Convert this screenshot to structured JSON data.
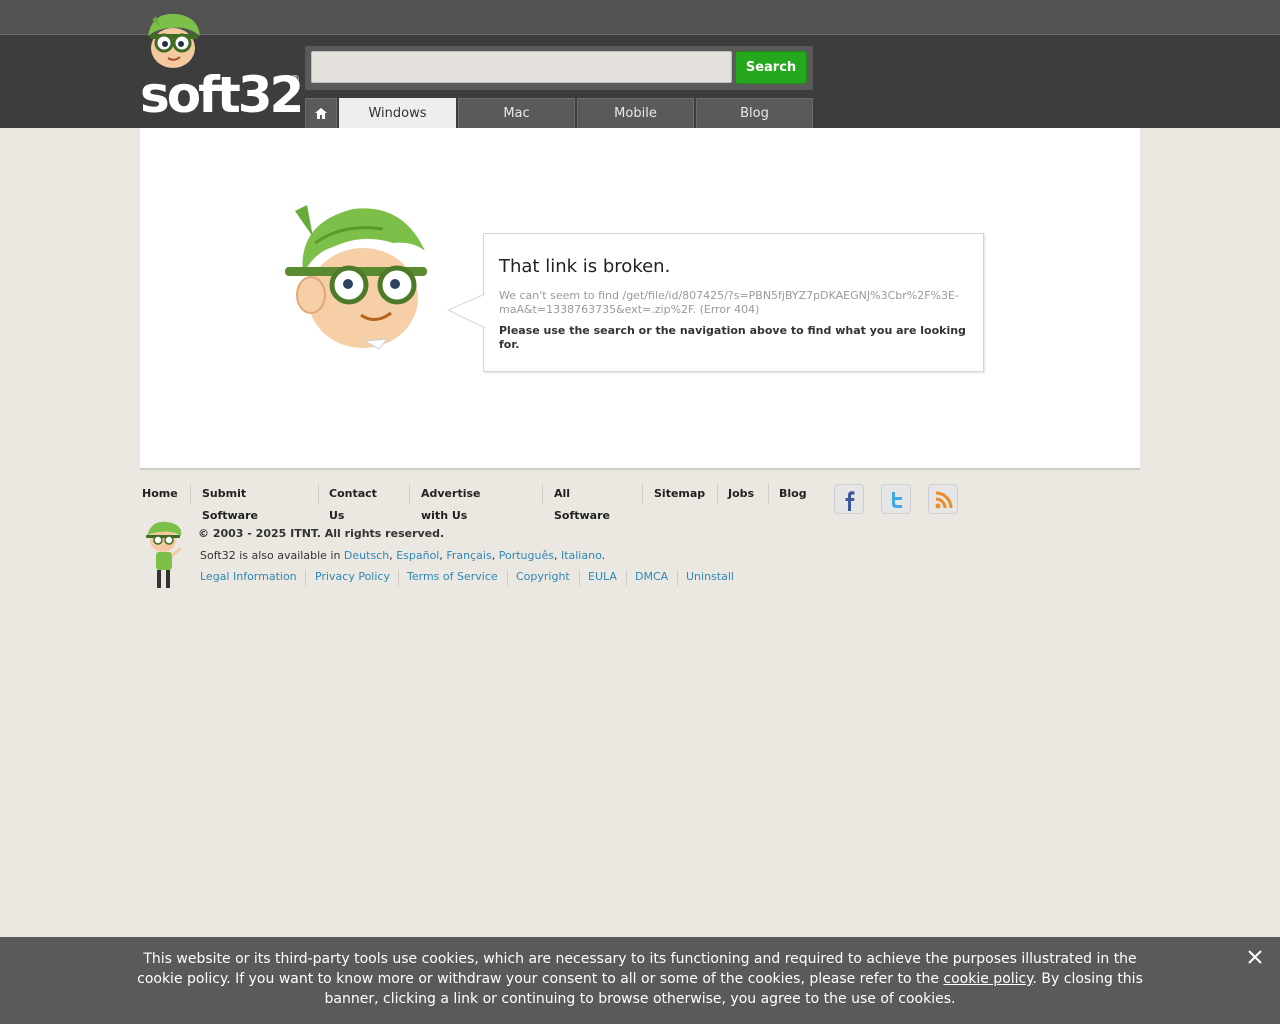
{
  "header": {
    "logo_text": "soft32",
    "logo_reg": "®",
    "search": {
      "value": "",
      "placeholder": "",
      "button_label": "Search"
    },
    "tabs": [
      {
        "label": "Windows",
        "active": true
      },
      {
        "label": "Mac",
        "active": false
      },
      {
        "label": "Mobile",
        "active": false
      },
      {
        "label": "Blog",
        "active": false
      }
    ],
    "home_icon": "home-icon"
  },
  "error": {
    "title": "That link is broken.",
    "detail": "We can't seem to find /get/file/id/807425/?s=PBN5fjBYZ7pDKAEGNJ%3Cbr%2F%3E-maA&t=1338763735&ext=.zip%2F. (Error 404)",
    "hint": "Please use the search or the navigation above to find what you are looking for."
  },
  "footer": {
    "nav": [
      "Home",
      "Submit Software",
      "Contact Us",
      "Advertise with Us",
      "All Software",
      "Sitemap",
      "Jobs",
      "Blog"
    ],
    "social": [
      "facebook-icon",
      "twitter-icon",
      "rss-icon"
    ],
    "copyright": "© 2003 - 2025 ITNT. All rights reserved.",
    "langs_prefix": "Soft32 is also available in",
    "langs": [
      "Deutsch",
      "Español",
      "Français",
      "Português",
      "Italiano"
    ],
    "legal": [
      "Legal Information",
      "Privacy Policy",
      "Terms of Service",
      "Copyright",
      "EULA",
      "DMCA",
      "Uninstall"
    ]
  },
  "cookie_banner": {
    "text_before": "This website or its third-party tools use cookies, which are necessary to its functioning and required to achieve the purposes illustrated in the cookie policy. If you want to know more or withdraw your consent to all or some of the cookies, please refer to the",
    "link": "cookie policy",
    "text_after": ". By closing this banner, clicking a link or continuing to browse otherwise, you agree to the use of cookies.",
    "close_icon": "close-icon"
  },
  "colors": {
    "header_dark": "#3d3d3d",
    "topbar": "#525252",
    "search_green": "#25a81d",
    "link_blue": "#2f86b8",
    "page_bg": "#ebe8e2",
    "mascot_green": "#7cc04a"
  }
}
